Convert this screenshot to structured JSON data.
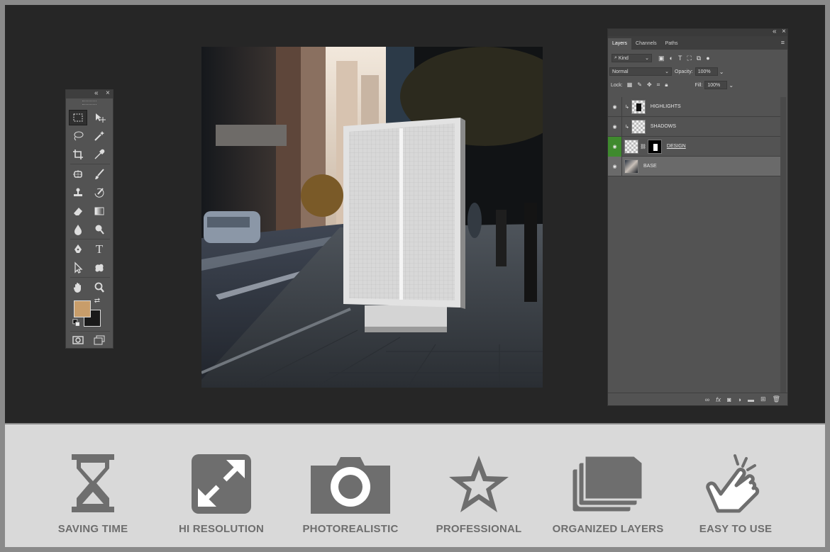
{
  "toolbox": {
    "collapse_icon": "double-chevron-left",
    "close_icon": "close",
    "foreground_color": "#c89d6a",
    "background_color": "#1a1a1a",
    "tools": [
      "rectangular-marquee",
      "move",
      "lasso",
      "magic-wand",
      "crop",
      "eyedropper",
      "spot-healing",
      "brush",
      "clone-stamp",
      "history-brush",
      "eraser",
      "gradient",
      "blur",
      "dodge",
      "pen",
      "type",
      "path-selection",
      "custom-shape",
      "hand",
      "zoom",
      "quick-mask",
      "screen-mode"
    ],
    "type_tool_glyph": "T"
  },
  "layers_panel": {
    "tabs": [
      {
        "label": "Layers",
        "active": true
      },
      {
        "label": "Channels",
        "active": false
      },
      {
        "label": "Paths",
        "active": false
      }
    ],
    "filter_kind": "Kind",
    "blend_mode": "Normal",
    "opacity_label": "Opacity:",
    "opacity_value": "100%",
    "lock_label": "Lock:",
    "fill_label": "Fill:",
    "fill_value": "100%",
    "layers": [
      {
        "name": "HIGHLIGHTS",
        "selected": false,
        "clipped": true
      },
      {
        "name": "SHADOWS",
        "selected": false,
        "clipped": true
      },
      {
        "name": "DESIGN",
        "selected": false,
        "smart_object": true
      },
      {
        "name": "BASE",
        "selected": true
      }
    ]
  },
  "features": [
    {
      "label": "SAVING TIME",
      "icon": "hourglass-icon"
    },
    {
      "label": "HI RESOLUTION",
      "icon": "expand-arrows-icon"
    },
    {
      "label": "PHOTOREALISTIC",
      "icon": "camera-icon"
    },
    {
      "label": "PROFESSIONAL",
      "icon": "star-icon"
    },
    {
      "label": "ORGANIZED LAYERS",
      "icon": "stacked-layers-icon"
    },
    {
      "label": "EASY TO USE",
      "icon": "tap-hand-icon"
    }
  ],
  "colors": {
    "workspace": "#262626",
    "panel": "#535353",
    "feature_icon": "#6e6e6e",
    "feature_band": "#d9d9d9",
    "visible_layer_green": "#3f8a2e"
  }
}
